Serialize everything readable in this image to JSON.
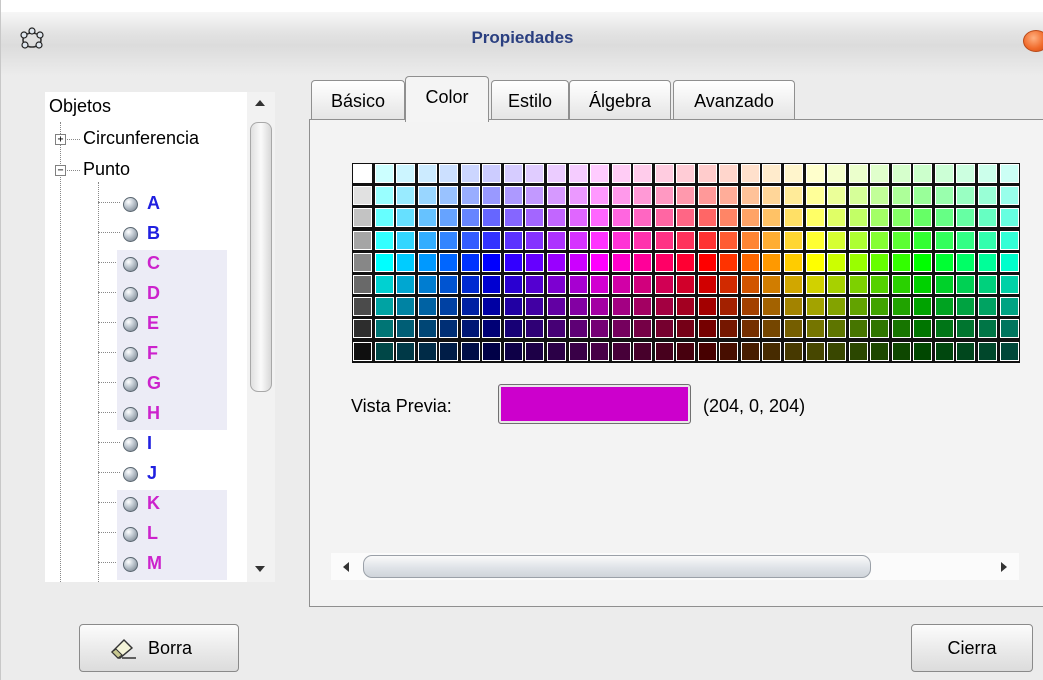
{
  "window": {
    "title": "Propiedades"
  },
  "tree": {
    "root_label": "Objetos",
    "groups": [
      {
        "label": "Circunferencia",
        "expanded": false,
        "expander": "+"
      },
      {
        "label": "Punto",
        "expanded": true,
        "expander": "−"
      }
    ],
    "points": [
      {
        "name": "A",
        "color": "#2020e0",
        "selected": false
      },
      {
        "name": "B",
        "color": "#2020e0",
        "selected": false
      },
      {
        "name": "C",
        "color": "#cc22cc",
        "selected": true
      },
      {
        "name": "D",
        "color": "#cc22cc",
        "selected": true
      },
      {
        "name": "E",
        "color": "#cc22cc",
        "selected": true
      },
      {
        "name": "F",
        "color": "#cc22cc",
        "selected": true
      },
      {
        "name": "G",
        "color": "#cc22cc",
        "selected": true
      },
      {
        "name": "H",
        "color": "#cc22cc",
        "selected": true
      },
      {
        "name": "I",
        "color": "#2020e0",
        "selected": false
      },
      {
        "name": "J",
        "color": "#2020e0",
        "selected": false
      },
      {
        "name": "K",
        "color": "#cc22cc",
        "selected": true
      },
      {
        "name": "L",
        "color": "#cc22cc",
        "selected": true
      },
      {
        "name": "M",
        "color": "#cc22cc",
        "selected": true
      }
    ]
  },
  "tabs": [
    {
      "label": "Básico",
      "active": false
    },
    {
      "label": "Color",
      "active": true
    },
    {
      "label": "Estilo",
      "active": false
    },
    {
      "label": "Álgebra",
      "active": false
    },
    {
      "label": "Avanzado",
      "active": false
    }
  ],
  "color_panel": {
    "preview_label": "Vista Previa:",
    "selected_color": "#cc00cc",
    "selected_rgb_text": "(204, 0, 204)"
  },
  "buttons": {
    "delete_label": "Borra",
    "close_label": "Cierra"
  },
  "colors": {
    "title_text": "#2a3f80",
    "close_button": "#f06a2a",
    "point_blue": "#2020e0",
    "point_magenta": "#cc22cc"
  }
}
